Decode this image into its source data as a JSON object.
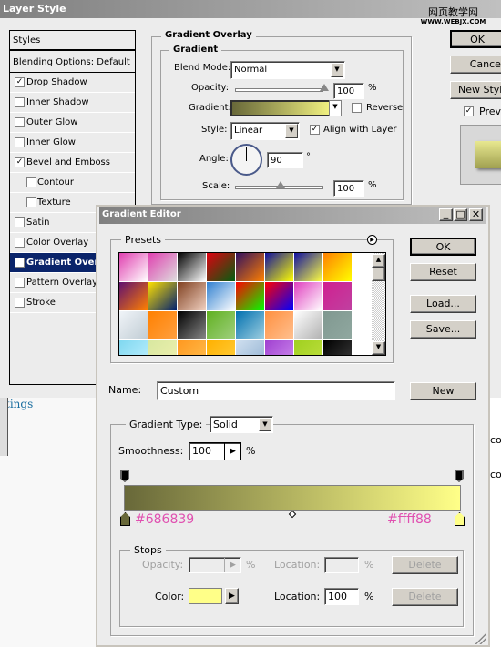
{
  "layer_style": {
    "title": "Layer Style",
    "watermark": "网页教学网",
    "watermark_url": "WWW.WEBJX.COM",
    "styles_header": "Styles",
    "blending": "Blending Options: Default",
    "items": [
      {
        "label": "Drop Shadow",
        "checked": true
      },
      {
        "label": "Inner Shadow",
        "checked": false
      },
      {
        "label": "Outer Glow",
        "checked": false
      },
      {
        "label": "Inner Glow",
        "checked": false
      },
      {
        "label": "Bevel and Emboss",
        "checked": true
      },
      {
        "label": "Contour",
        "checked": false,
        "sub": true
      },
      {
        "label": "Texture",
        "checked": false,
        "sub": true
      },
      {
        "label": "Satin",
        "checked": false
      },
      {
        "label": "Color Overlay",
        "checked": false
      },
      {
        "label": "Gradient Overlay",
        "checked": true,
        "selected": true
      },
      {
        "label": "Pattern Overlay",
        "checked": false
      },
      {
        "label": "Stroke",
        "checked": false
      }
    ],
    "section_title": "Gradient Overlay",
    "group_title": "Gradient",
    "blend_mode_label": "Blend Mode:",
    "blend_mode": "Normal",
    "opacity_label": "Opacity:",
    "opacity": "100",
    "opacity_pct": 100,
    "pct": "%",
    "gradient_label": "Gradient:",
    "reverse_label": "Reverse",
    "reverse": false,
    "style_label": "Style:",
    "style": "Linear",
    "align_label": "Align with Layer",
    "align": true,
    "angle_label": "Angle:",
    "angle": "90",
    "deg": "°",
    "scale_label": "Scale:",
    "scale": "100",
    "scale_pct": 50,
    "ok": "OK",
    "cancel": "Cancel",
    "new_style": "New Style...",
    "preview": "Preview",
    "preview_checked": true
  },
  "background": {
    "link_text": "tings",
    "right_text_1": "co",
    "right_text_2": "co"
  },
  "gradient_editor": {
    "title": "Gradient Editor",
    "presets_label": "Presets",
    "presets": [
      [
        "#e040b0",
        "#fff"
      ],
      [
        "#e040b0",
        "#ddd"
      ],
      [
        "#000",
        "#fff"
      ],
      [
        "#e00010",
        "#006010"
      ],
      [
        "#301060",
        "#ff8000"
      ],
      [
        "#1010a0",
        "#ffff00"
      ],
      [
        "#1010a0",
        "#ffff40"
      ],
      [
        "#ff8000",
        "#ffff00"
      ],
      [
        "#601070",
        "#ff8000"
      ],
      [
        "#ffe000",
        "#002070"
      ],
      [
        "#804020",
        "#f0d0c0"
      ],
      [
        "#3080d0",
        "#fff"
      ],
      [
        "#ff0000",
        "#00ff00"
      ],
      [
        "#ff0000",
        "#0000ff"
      ],
      [
        "#e040c0",
        "#fff"
      ],
      [
        "#d02090",
        "#c040a0"
      ],
      [
        "#f0f4f8",
        "#c0ccd4"
      ],
      [
        "#ff8000",
        "#ffa040"
      ],
      [
        "#000",
        "#888"
      ],
      [
        "#60b020",
        "#a0d080"
      ],
      [
        "#0070b0",
        "#a0d0e0"
      ],
      [
        "#ff9040",
        "#ffc090"
      ],
      [
        "#fff",
        "#b0b0b0"
      ],
      [
        "#809890",
        "#90a8a0"
      ],
      [
        "#80d8f0",
        "#c0f0ff"
      ],
      [
        "#d8e8a0",
        "#f0f0b0"
      ],
      [
        "#ff9820",
        "#ffc050"
      ],
      [
        "#ffb000",
        "#ffd040"
      ],
      [
        "#d0e0f0",
        "#90b0d0"
      ],
      [
        "#a040d0",
        "#d090f0"
      ],
      [
        "#a0d020",
        "#c0e040"
      ],
      [
        "#000",
        "#404040"
      ]
    ],
    "ok": "OK",
    "reset": "Reset",
    "load": "Load...",
    "save": "Save...",
    "name_label": "Name:",
    "name": "Custom",
    "new": "New",
    "type_label": "Gradient Type:",
    "type": "Solid",
    "smooth_label": "Smoothness:",
    "smoothness": "100",
    "pct": "%",
    "color_start": "#686839",
    "color_end": "#ffff88",
    "annot_start": "#686839",
    "annot_end": "#ffff88",
    "annot_color": "#e050b0",
    "stops_label": "Stops",
    "opacity_label": "Opacity:",
    "location_label": "Location:",
    "delete": "Delete",
    "color_label": "Color:",
    "location": "100",
    "selection_color": "#0a246a"
  }
}
